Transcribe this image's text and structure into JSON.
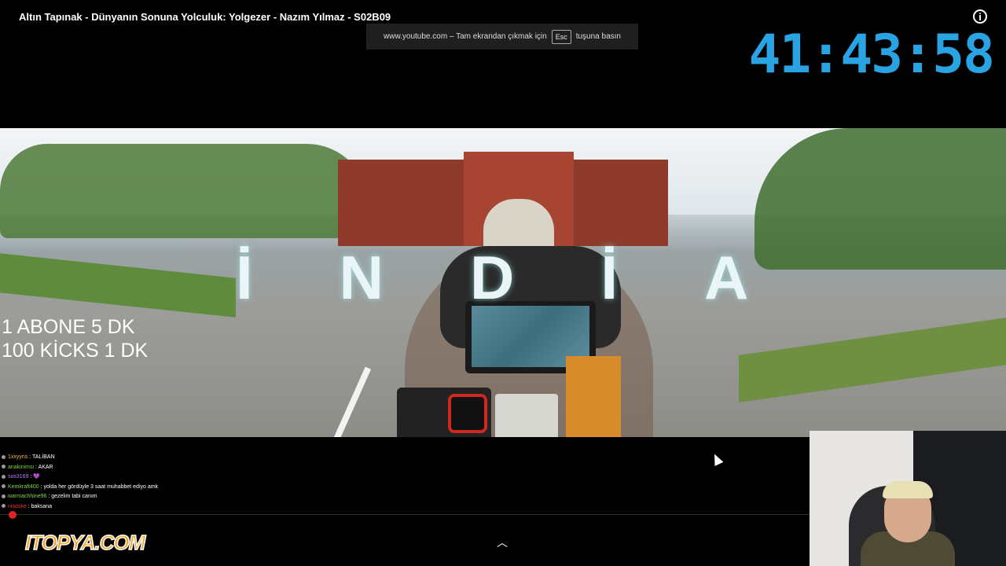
{
  "window": {
    "title": "Altın Tapınak - Dünyanın Sonuna Yolculuk: Yolgezer - Nazım Yılmaz - S02B09"
  },
  "fullscreen_toast": {
    "before": "www.youtube.com – Tam ekrandan çıkmak için",
    "key": "Esc",
    "after": "tuşuna basın"
  },
  "timer": "41:43:58",
  "video": {
    "banner": "İNDİA"
  },
  "overlay": {
    "line1": "1 ABONE 5 DK",
    "line2": "100 KİCKS  1 DK"
  },
  "chat": [
    {
      "user": "1xxyyns",
      "color": "#f5b342",
      "text": "TALİBAN"
    },
    {
      "user": "anakinimsi",
      "color": "#7cd44a",
      "text": "AKAR"
    },
    {
      "user": "sos3169",
      "color": "#b57cff",
      "text": "💜"
    },
    {
      "user": "Kemkraft400",
      "color": "#7cd44a",
      "text": "yolda her gördüyle 3 saat muhabbet ediyo amk"
    },
    {
      "user": "warmachhine96",
      "color": "#7cd44a",
      "text": "gezelim tabi canım"
    },
    {
      "user": "nisoske",
      "color": "#e33b3b",
      "text": "baksana"
    }
  ],
  "logo": "ITOPYA.COM",
  "colors": {
    "timer": "#2aa3e2",
    "logo": "#f3a021"
  }
}
